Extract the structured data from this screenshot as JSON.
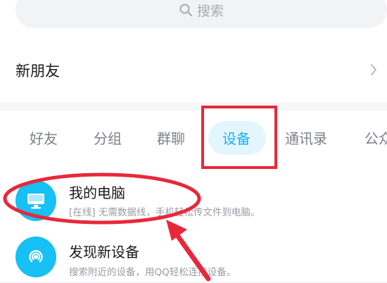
{
  "search": {
    "placeholder": "搜索",
    "icon": "search-icon"
  },
  "new_friends": {
    "label": "新朋友",
    "icon": "chevron-right-icon"
  },
  "tabs": [
    {
      "label": "好友",
      "active": false
    },
    {
      "label": "分组",
      "active": false
    },
    {
      "label": "群聊",
      "active": false
    },
    {
      "label": "设备",
      "active": true
    },
    {
      "label": "通讯录",
      "active": false
    },
    {
      "label": "公众",
      "active": false
    }
  ],
  "devices": [
    {
      "title": "我的电脑",
      "status_tag": "[在线]",
      "description": "无需数据线，手机轻松传文件到电脑。",
      "icon": "computer-icon"
    },
    {
      "title": "发现新设备",
      "description": "搜索附近的设备，用QQ轻松连接设备。",
      "icon": "radar-icon"
    }
  ],
  "colors": {
    "accent": "#1ab0f5",
    "annotation_red": "#e8283a",
    "device_icon_bg": "#17c0f5",
    "active_tab_pill": "#e4f6fd"
  }
}
